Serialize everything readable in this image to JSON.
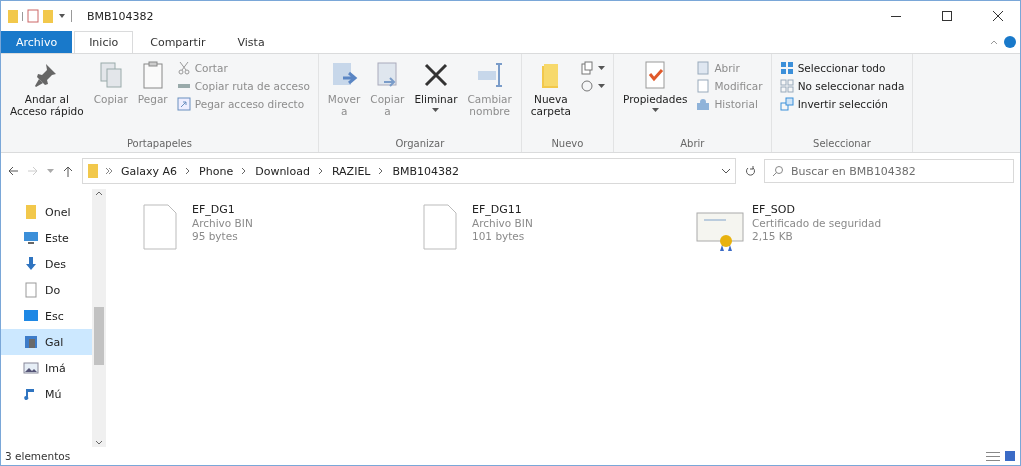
{
  "window": {
    "title": "BMB104382"
  },
  "tabs": [
    {
      "label": "Archivo",
      "kind": "file",
      "selected": false
    },
    {
      "label": "Inicio",
      "kind": "tab",
      "selected": true
    },
    {
      "label": "Compartir",
      "kind": "tab",
      "selected": false
    },
    {
      "label": "Vista",
      "kind": "tab",
      "selected": false
    }
  ],
  "ribbon": {
    "groups": [
      {
        "label": "Portapapeles",
        "items": [
          {
            "kind": "large",
            "label": "Andar al\nAcceso rápido",
            "disabled": false,
            "caret": false
          },
          {
            "kind": "large",
            "label": "Copiar",
            "disabled": true,
            "caret": false
          },
          {
            "kind": "large",
            "label": "Pegar",
            "disabled": true,
            "caret": false
          },
          {
            "kind": "stack",
            "items": [
              {
                "label": "Cortar",
                "disabled": true
              },
              {
                "label": "Copiar ruta de acceso",
                "disabled": true
              },
              {
                "label": "Pegar acceso directo",
                "disabled": true
              }
            ]
          }
        ]
      },
      {
        "label": "Organizar",
        "items": [
          {
            "kind": "large",
            "label": "Mover\na",
            "disabled": true,
            "caret": false
          },
          {
            "kind": "large",
            "label": "Copiar\na",
            "disabled": true,
            "caret": false
          },
          {
            "kind": "large",
            "label": "Eliminar",
            "disabled": false,
            "caret": true
          },
          {
            "kind": "large",
            "label": "Cambiar\nnombre",
            "disabled": true,
            "caret": false
          }
        ]
      },
      {
        "label": "Nuevo",
        "items": [
          {
            "kind": "large",
            "label": "Nueva\ncarpeta",
            "disabled": false,
            "caret": false
          },
          {
            "kind": "iconstack",
            "items": [
              {
                "disabled": false
              },
              {
                "disabled": false
              }
            ]
          }
        ]
      },
      {
        "label": "Abrir",
        "items": [
          {
            "kind": "large",
            "label": "Propiedades",
            "disabled": false,
            "caret": true
          },
          {
            "kind": "stack",
            "items": [
              {
                "label": "Abrir",
                "disabled": true
              },
              {
                "label": "Modificar",
                "disabled": true
              },
              {
                "label": "Historial",
                "disabled": true
              }
            ]
          }
        ]
      },
      {
        "label": "Seleccionar",
        "items": [
          {
            "kind": "stack",
            "items": [
              {
                "label": "Seleccionar todo",
                "disabled": false
              },
              {
                "label": "No seleccionar nada",
                "disabled": false
              },
              {
                "label": "Invertir selección",
                "disabled": false
              }
            ]
          }
        ]
      }
    ]
  },
  "address": {
    "crumbs": [
      "Galaxy A6",
      "Phone",
      "Download",
      "RAZIEL",
      "BMB104382"
    ],
    "search_placeholder": "Buscar en BMB104382"
  },
  "sidebar": {
    "items": [
      {
        "label": "Onel",
        "selected": false
      },
      {
        "label": "Este",
        "selected": false
      },
      {
        "label": "Des",
        "selected": false
      },
      {
        "label": "Do",
        "selected": false
      },
      {
        "label": "Esc",
        "selected": false
      },
      {
        "label": "Gal",
        "selected": true
      },
      {
        "label": "Imá",
        "selected": false
      },
      {
        "label": "Mú",
        "selected": false
      }
    ]
  },
  "files": [
    {
      "name": "EF_DG1",
      "type": "Archivo BIN",
      "size": "95 bytes",
      "kind": "file"
    },
    {
      "name": "EF_DG11",
      "type": "Archivo BIN",
      "size": "101 bytes",
      "kind": "file"
    },
    {
      "name": "EF_SOD",
      "type": "Certificado de seguridad",
      "size": "2,15 KB",
      "kind": "certificate"
    }
  ],
  "status_bar": {
    "count": "3 elementos"
  }
}
